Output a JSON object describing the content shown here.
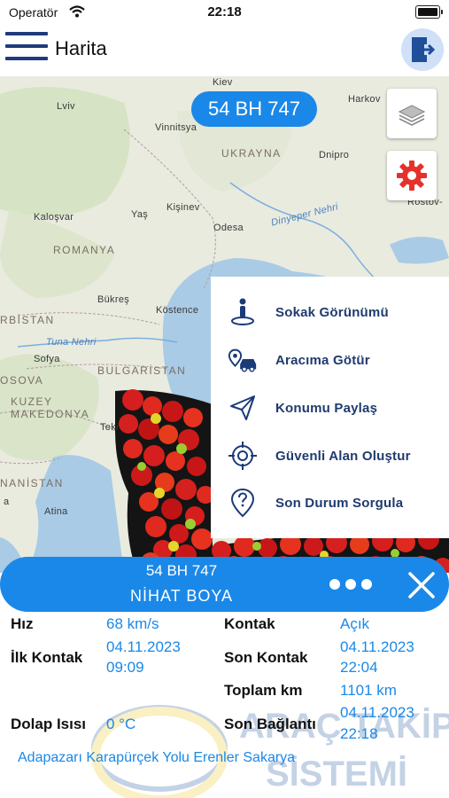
{
  "status_bar": {
    "carrier": "Operatör",
    "time": "22:18"
  },
  "nav": {
    "title": "Harita"
  },
  "map": {
    "plate_pill": "54 BH 747",
    "labels": {
      "kiev": "Kiev",
      "harkov": "Harkov",
      "lviv": "Lviv",
      "vinnitsya": "Vinnitsya",
      "ukrayna": "UKRAYNA",
      "dnipro": "Dnipro",
      "kisinev": "Kişinev",
      "yas": "Yaş",
      "kalosvar": "Kaloşvar",
      "romanya": "ROMANYA",
      "odesa": "Odesa",
      "dinyeper": "Dinyeper Nehri",
      "rostov": "Rostov-",
      "bukres": "Bükreş",
      "kostence": "Köstence",
      "rbistan": "RBİSTAN",
      "tuna": "Tuna Nehri",
      "sofya": "Sofya",
      "bulgaristan": "BULGARİSTAN",
      "osova": "OSOVA",
      "kuzey": "KUZEY",
      "makedonya": "MAKEDONYA",
      "teki": "Teki",
      "nanistan": "NANİSTAN",
      "atina": "Atina",
      "pa": "a"
    }
  },
  "menu": {
    "items": [
      {
        "label": "Sokak Görünümü",
        "icon": "street-view-icon"
      },
      {
        "label": "Aracıma Götür",
        "icon": "car-location-icon"
      },
      {
        "label": "Konumu Paylaş",
        "icon": "share-location-icon"
      },
      {
        "label": "Güvenli Alan Oluştur",
        "icon": "target-icon"
      },
      {
        "label": "Son Durum Sorgula",
        "icon": "question-pin-icon"
      }
    ]
  },
  "vehicle": {
    "plate": "54 BH 747",
    "driver": "NİHAT BOYA"
  },
  "info": {
    "speed_label": "Hız",
    "speed_value": "68 km/s",
    "ignition_label": "Kontak",
    "ignition_value": "Açık",
    "first_label": "İlk Kontak",
    "first_date": "04.11.2023",
    "first_time": "09:09",
    "last_label": "Son Kontak",
    "last_date": "04.11.2023",
    "last_time": "22:04",
    "total_label": "Toplam km",
    "total_value": "1101 km",
    "temp_label": "Dolap Isısı",
    "temp_value": "0 °C",
    "conn_label": "Son Bağlantı",
    "conn_date": "04.11.2023",
    "conn_time": "22:18",
    "address": "Adapazarı Karapürçek Yolu Erenler Sakarya"
  },
  "watermark": {
    "line1": "ARAÇ TAKİP",
    "line2": "SİSTEMİ"
  },
  "colors": {
    "accent": "#1a88e8",
    "menu_text": "#1f3b6e",
    "sea": "#a9cbe6",
    "land": "#e8eadf"
  }
}
